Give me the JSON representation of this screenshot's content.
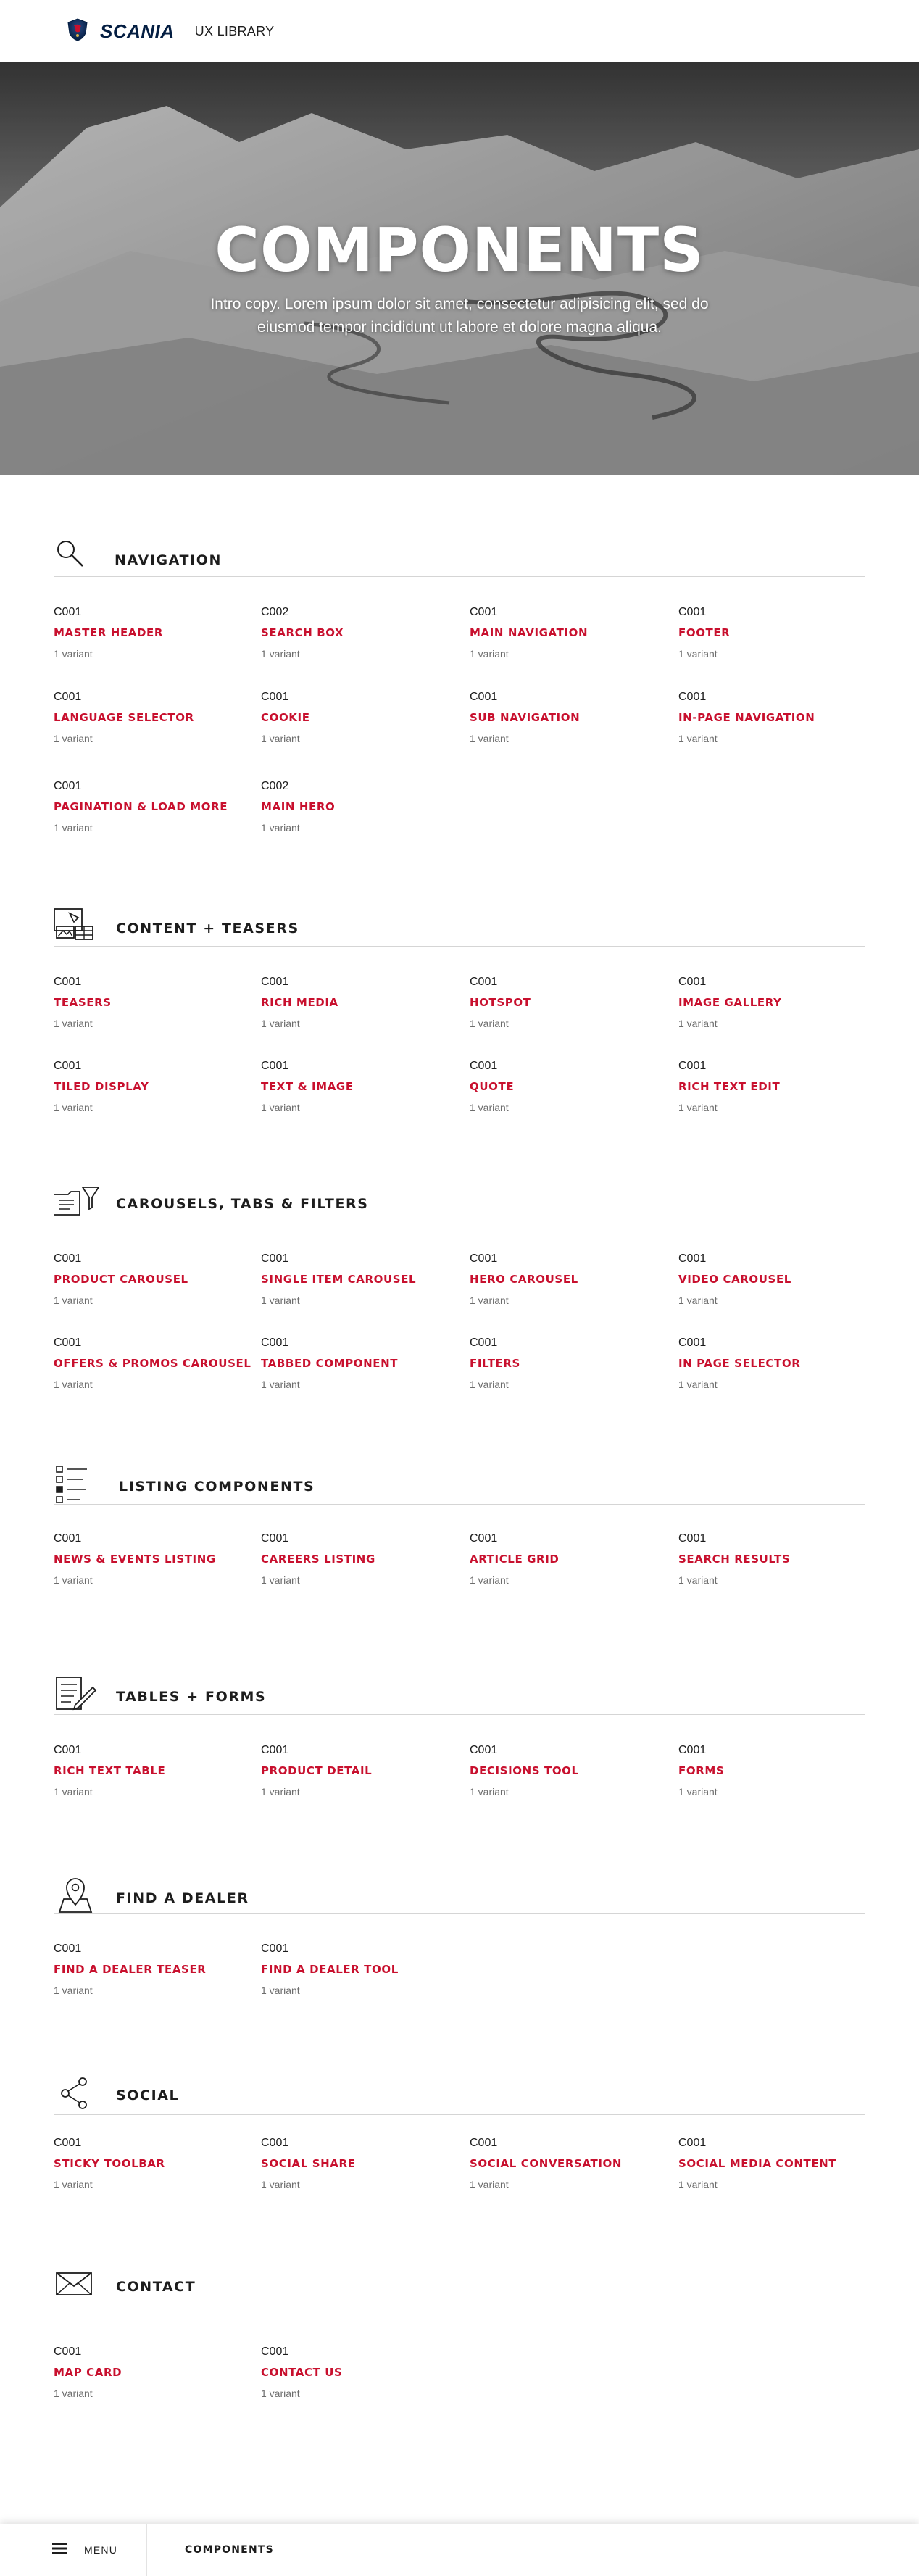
{
  "header": {
    "brand": "SCANIA",
    "subtitle": "UX LIBRARY"
  },
  "hero": {
    "title": "COMPONENTS",
    "intro": "Intro copy. Lorem ipsum dolor sit amet, consectetur adipisicing elit, sed do eiusmod tempor incididunt ut labore et dolore magna aliqua."
  },
  "sections": [
    {
      "title": "NAVIGATION",
      "icon": "search-icon",
      "items": [
        {
          "code": "C001",
          "name": "MASTER HEADER",
          "variants": "1 variant"
        },
        {
          "code": "C002",
          "name": "SEARCH BOX",
          "variants": "1 variant"
        },
        {
          "code": "C001",
          "name": "MAIN NAVIGATION",
          "variants": "1 variant"
        },
        {
          "code": "C001",
          "name": "FOOTER",
          "variants": "1 variant"
        },
        {
          "code": "C001",
          "name": "LANGUAGE SELECTOR",
          "variants": "1 variant"
        },
        {
          "code": "C001",
          "name": "COOKIE",
          "variants": "1 variant"
        },
        {
          "code": "C001",
          "name": "SUB NAVIGATION",
          "variants": "1 variant"
        },
        {
          "code": "C001",
          "name": "IN-PAGE NAVIGATION",
          "variants": "1 variant"
        },
        {
          "code": "C001",
          "name": "PAGINATION & LOAD MORE",
          "variants": "1 variant"
        },
        {
          "code": "C002",
          "name": "MAIN HERO",
          "variants": "1 variant"
        }
      ]
    },
    {
      "title": "CONTENT + TEASERS",
      "icon": "content-teasers-icon",
      "items": [
        {
          "code": "C001",
          "name": "TEASERS",
          "variants": "1 variant"
        },
        {
          "code": "C001",
          "name": "RICH MEDIA",
          "variants": "1 variant"
        },
        {
          "code": "C001",
          "name": "HOTSPOT",
          "variants": "1 variant"
        },
        {
          "code": "C001",
          "name": "IMAGE GALLERY",
          "variants": "1 variant"
        },
        {
          "code": "C001",
          "name": "TILED DISPLAY",
          "variants": "1 variant"
        },
        {
          "code": "C001",
          "name": "TEXT & IMAGE",
          "variants": "1 variant"
        },
        {
          "code": "C001",
          "name": "QUOTE",
          "variants": "1 variant"
        },
        {
          "code": "C001",
          "name": "RICH TEXT EDIT",
          "variants": "1 variant"
        }
      ]
    },
    {
      "title": "CAROUSELS, TABS & FILTERS",
      "icon": "folder-filter-icon",
      "items": [
        {
          "code": "C001",
          "name": "PRODUCT CAROUSEL",
          "variants": "1 variant"
        },
        {
          "code": "C001",
          "name": "SINGLE ITEM CAROUSEL",
          "variants": "1 variant"
        },
        {
          "code": "C001",
          "name": "HERO CAROUSEL",
          "variants": "1 variant"
        },
        {
          "code": "C001",
          "name": "VIDEO CAROUSEL",
          "variants": "1 variant"
        },
        {
          "code": "C001",
          "name": "OFFERS & PROMOS CAROUSEL",
          "variants": "1 variant"
        },
        {
          "code": "C001",
          "name": "TABBED COMPONENT",
          "variants": "1 variant"
        },
        {
          "code": "C001",
          "name": "FILTERS",
          "variants": "1 variant"
        },
        {
          "code": "C001",
          "name": "IN PAGE SELECTOR",
          "variants": "1 variant"
        }
      ]
    },
    {
      "title": "LISTING COMPONENTS",
      "icon": "checklist-icon",
      "items": [
        {
          "code": "C001",
          "name": "NEWS & EVENTS LISTING",
          "variants": "1 variant"
        },
        {
          "code": "C001",
          "name": "CAREERS LISTING",
          "variants": "1 variant"
        },
        {
          "code": "C001",
          "name": "ARTICLE GRID",
          "variants": "1 variant"
        },
        {
          "code": "C001",
          "name": "SEARCH RESULTS",
          "variants": "1 variant"
        }
      ]
    },
    {
      "title": "TABLES + FORMS",
      "icon": "form-pencil-icon",
      "items": [
        {
          "code": "C001",
          "name": "RICH TEXT TABLE",
          "variants": "1 variant"
        },
        {
          "code": "C001",
          "name": "PRODUCT DETAIL",
          "variants": "1 variant"
        },
        {
          "code": "C001",
          "name": "DECISIONS TOOL",
          "variants": "1 variant"
        },
        {
          "code": "C001",
          "name": "FORMS",
          "variants": "1 variant"
        }
      ]
    },
    {
      "title": "FIND A DEALER",
      "icon": "map-pin-icon",
      "items": [
        {
          "code": "C001",
          "name": "FIND A DEALER TEASER",
          "variants": "1 variant"
        },
        {
          "code": "C001",
          "name": "FIND A DEALER TOOL",
          "variants": "1 variant"
        }
      ]
    },
    {
      "title": "SOCIAL",
      "icon": "share-icon",
      "items": [
        {
          "code": "C001",
          "name": "STICKY TOOLBAR",
          "variants": "1 variant"
        },
        {
          "code": "C001",
          "name": "SOCIAL SHARE",
          "variants": "1 variant"
        },
        {
          "code": "C001",
          "name": "SOCIAL CONVERSATION",
          "variants": "1 variant"
        },
        {
          "code": "C001",
          "name": "SOCIAL MEDIA CONTENT",
          "variants": "1 variant"
        }
      ]
    },
    {
      "title": "CONTACT",
      "icon": "envelope-icon",
      "items": [
        {
          "code": "C001",
          "name": "MAP CARD",
          "variants": "1 variant"
        },
        {
          "code": "C001",
          "name": "CONTACT US",
          "variants": "1 variant"
        }
      ]
    }
  ],
  "footer": {
    "menu_label": "MENU",
    "breadcrumb": "COMPONENTS"
  },
  "colors": {
    "accent": "#c8102e",
    "brand": "#041e42",
    "text": "#1d1d1d",
    "muted": "#6d6d6d"
  }
}
